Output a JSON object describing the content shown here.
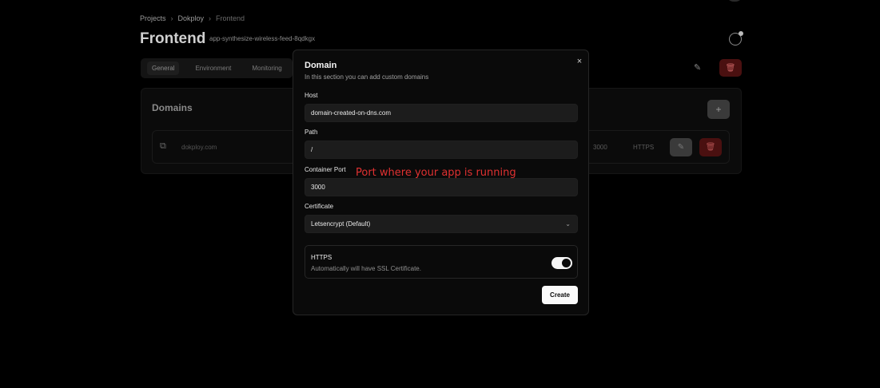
{
  "breadcrumb": [
    "Projects",
    "Dokploy",
    "Frontend"
  ],
  "page": {
    "title": "Frontend",
    "app_name": "app-synthesize-wireless-feed-8qdkgx"
  },
  "tabs": [
    {
      "label": "General"
    },
    {
      "label": "Environment"
    },
    {
      "label": "Monitoring"
    }
  ],
  "domains_section": {
    "title": "Domains",
    "add_label": "+",
    "row": {
      "domain": "dokploy.com",
      "port": "3000",
      "protocol": "HTTPS"
    }
  },
  "modal": {
    "title": "Domain",
    "description": "In this section you can add custom domains",
    "close_label": "×",
    "host": {
      "label": "Host",
      "value": "domain-created-on-dns.com"
    },
    "path": {
      "label": "Path",
      "value": "/"
    },
    "port": {
      "label": "Container Port",
      "value": "3000"
    },
    "certificate": {
      "label": "Certificate",
      "value": "Letsencrypt (Default)"
    },
    "https": {
      "title": "HTTPS",
      "description": "Automatically will have SSL Certificate.",
      "enabled": true
    },
    "create_label": "Create"
  },
  "annotation": "Port where your app is running",
  "icons": {
    "edit": "edit-icon",
    "delete": "trash-icon",
    "external_link": "external-link-icon",
    "globe": "globe-icon",
    "close": "close-icon",
    "chevron": "chevron-down-icon"
  },
  "colors": {
    "background": "#000000",
    "modal": "#0a0a0a",
    "danger": "#4a1010",
    "annotation": "#e03131",
    "primary_button": "#fafafa"
  }
}
